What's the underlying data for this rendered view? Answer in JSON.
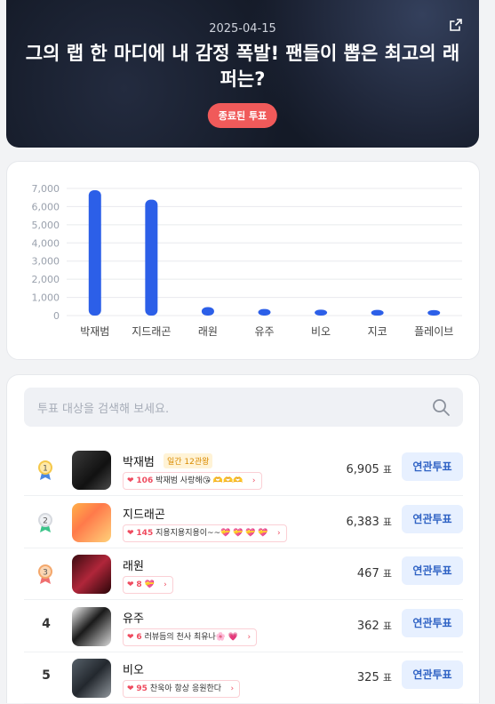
{
  "header": {
    "date": "2025-04-15",
    "title": "그의 랩 한 마디에 내 감정 폭발! 팬들이 뽑은 최고의 래퍼는?",
    "status_badge": "종료된 투표",
    "share_icon": "share-external-icon"
  },
  "chart_data": {
    "type": "bar",
    "categories": [
      "박재범",
      "지드래곤",
      "래원",
      "유주",
      "비오",
      "지코",
      "플레이브"
    ],
    "values": [
      6905,
      6383,
      467,
      362,
      325,
      310,
      300
    ],
    "yticks": [
      "0",
      "1,000",
      "2,000",
      "3,000",
      "4,000",
      "5,000",
      "6,000",
      "7,000"
    ],
    "ylim": [
      0,
      7000
    ],
    "grid": true,
    "bar_color": "#2c5fe8"
  },
  "search": {
    "placeholder": "투표 대상을 검색해 보세요.",
    "icon": "search-icon"
  },
  "candidates": [
    {
      "rank": "1",
      "medal": "gold",
      "name": "박재범",
      "weekly_badge": "일간 12관왕",
      "cheer_count": "106",
      "cheer_msg": "박재범 사랑해😘 🫶🫶🫶",
      "votes": "6,905",
      "unit": "표",
      "button": "연관투표"
    },
    {
      "rank": "2",
      "medal": "silver",
      "name": "지드래곤",
      "weekly_badge": "",
      "cheer_count": "145",
      "cheer_msg": "지용지용지용이~~💝 💝 💝 💝",
      "votes": "6,383",
      "unit": "표",
      "button": "연관투표"
    },
    {
      "rank": "3",
      "medal": "bronze",
      "name": "래원",
      "weekly_badge": "",
      "cheer_count": "8",
      "cheer_msg": "💝",
      "votes": "467",
      "unit": "표",
      "button": "연관투표"
    },
    {
      "rank": "4",
      "medal": "",
      "name": "유주",
      "weekly_badge": "",
      "cheer_count": "6",
      "cheer_msg": "러뷰듬의 천사 최유나🌸 💗",
      "votes": "362",
      "unit": "표",
      "button": "연관투표"
    },
    {
      "rank": "5",
      "medal": "",
      "name": "비오",
      "weekly_badge": "",
      "cheer_count": "95",
      "cheer_msg": "찬욱아 항상 응원한다",
      "votes": "325",
      "unit": "표",
      "button": "연관투표"
    }
  ]
}
